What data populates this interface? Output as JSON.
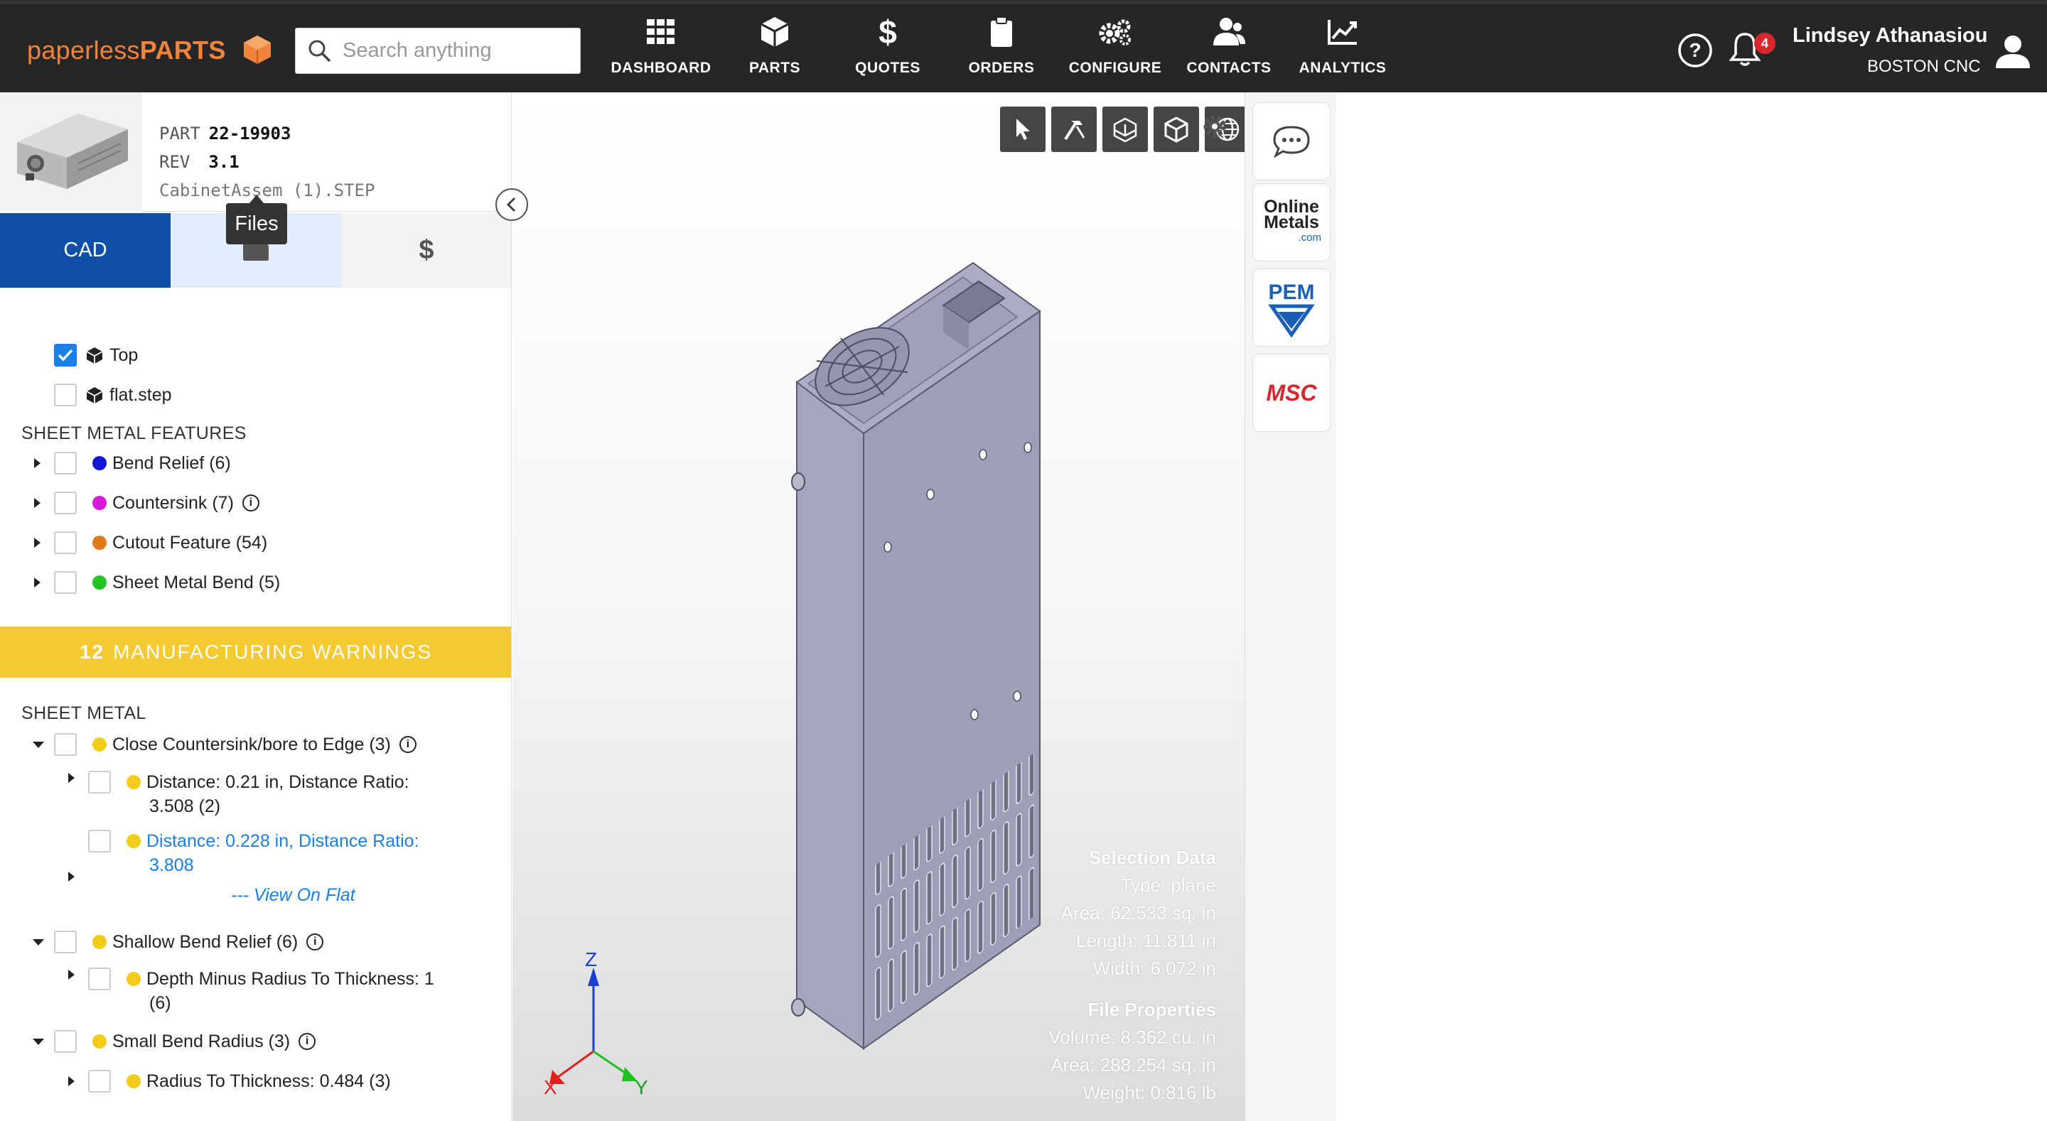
{
  "app": {
    "logo_light": "paperless",
    "logo_bold": "PARTS"
  },
  "search": {
    "placeholder": "Search anything"
  },
  "nav": [
    {
      "label": "DASHBOARD",
      "icon": "grid-icon"
    },
    {
      "label": "PARTS",
      "icon": "cube-icon"
    },
    {
      "label": "QUOTES",
      "icon": "dollar-icon"
    },
    {
      "label": "ORDERS",
      "icon": "clipboard-icon"
    },
    {
      "label": "CONFIGURE",
      "icon": "gears-icon"
    },
    {
      "label": "CONTACTS",
      "icon": "people-icon"
    },
    {
      "label": "ANALYTICS",
      "icon": "chart-icon"
    }
  ],
  "user": {
    "name": "Lindsey Athanasiou",
    "company": "BOSTON CNC",
    "notifications": "4"
  },
  "part": {
    "part_label": "PART",
    "part_number": "22-19903",
    "rev_label": "REV",
    "rev": "3.1",
    "filename": "CabinetAssem (1).STEP"
  },
  "tabs": {
    "cad": "CAD",
    "tooltip": "Files"
  },
  "tree": {
    "items": [
      {
        "label": "Top",
        "checked": true
      },
      {
        "label": "flat.step",
        "checked": false
      }
    ],
    "sheet_metal_header": "SHEET METAL FEATURES",
    "features": [
      {
        "label": "Bend Relief (6)",
        "color": "#1414d6"
      },
      {
        "label": "Countersink (7)",
        "color": "#d61ad6"
      },
      {
        "label": "Cutout Feature (54)",
        "color": "#e07a1f"
      },
      {
        "label": "Sheet Metal Bend (5)",
        "color": "#22c422"
      }
    ]
  },
  "warnings": {
    "count": "12",
    "title": "MANUFACTURING WARNINGS",
    "section": "SHEET METAL",
    "groups": [
      {
        "label": "Close Countersink/bore to Edge (3)"
      },
      {
        "label": "Shallow Bend Relief (6)"
      },
      {
        "label": "Small Bend Radius (3)"
      }
    ],
    "sub1a_line1": "Distance: 0.21 in, Distance Ratio:",
    "sub1a_line2": "3.508 (2)",
    "sub1b_line1": "Distance: 0.228 in, Distance Ratio:",
    "sub1b_line2": "3.808",
    "view_on_flat": "--- View On Flat",
    "sub2_line1": "Depth Minus Radius To Thickness: 1",
    "sub2_line2": "(6)",
    "sub3": "Radius To Thickness: 0.484 (3)",
    "dot_color": "#f2cc1a"
  },
  "selection": {
    "title": "Selection Data",
    "type": "Type:  plane",
    "area": "Area:  62.533 sq. in",
    "length": "Length:  11.811 in",
    "width": "Width:  6.072 in"
  },
  "file_props": {
    "title": "File Properties",
    "volume": "Volume: 8.362 cu. in",
    "area": "Area: 288.254 sq. in",
    "weight": "Weight: 0.816 lb"
  },
  "axes": {
    "x": "X",
    "y": "Y",
    "z": "Z"
  },
  "rail": {
    "online_metals_1": "Online",
    "online_metals_2": "Metals",
    "online_metals_3": ".com",
    "pem": "PEM",
    "msc": "MSC"
  },
  "colors": {
    "topbar": "#262626",
    "brand_orange": "#f0843c",
    "cad_tab": "#0f4fa6",
    "warning": "#f4c932",
    "link": "#1a7fe6"
  }
}
